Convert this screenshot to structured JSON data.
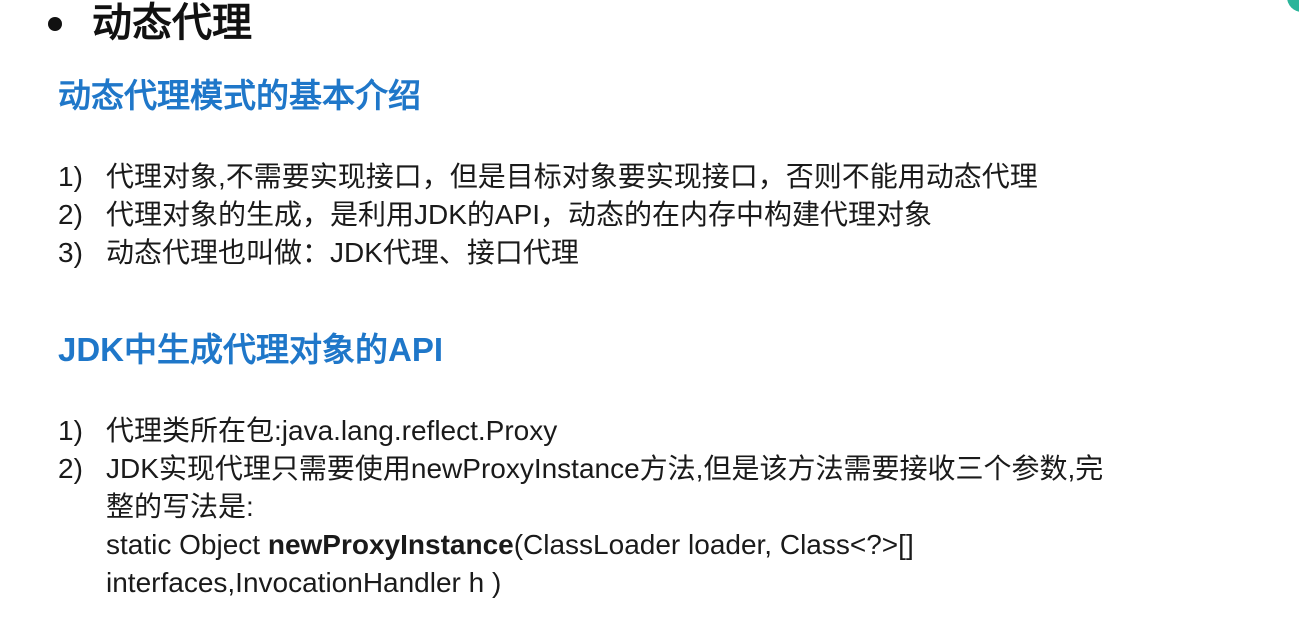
{
  "slide": {
    "title": "动态代理",
    "section1": {
      "heading": "动态代理模式的基本介绍",
      "items": [
        {
          "num": "1)",
          "text": "代理对象,不需要实现接口，但是目标对象要实现接口，否则不能用动态代理"
        },
        {
          "num": "2)",
          "text": "代理对象的生成，是利用JDK的API，动态的在内存中构建代理对象"
        },
        {
          "num": "3)",
          "text": "动态代理也叫做：JDK代理、接口代理"
        }
      ]
    },
    "section2": {
      "heading": "JDK中生成代理对象的API",
      "item1": {
        "num": "1)",
        "text": "代理类所在包:java.lang.reflect.Proxy"
      },
      "item2": {
        "num": "2)",
        "text_line1": "JDK实现代理只需要使用newProxyInstance方法,但是该方法需要接收三个参数,完",
        "text_line2": "整的写法是:",
        "code_prefix": "static Object ",
        "code_method": "newProxyInstance",
        "code_suffix": "(ClassLoader loader, Class<?>[]",
        "code_line2": "interfaces,InvocationHandler h )"
      }
    }
  },
  "colors": {
    "heading": "#1f77c9",
    "accent": "#2bb59a",
    "text": "#1a1a1a"
  }
}
